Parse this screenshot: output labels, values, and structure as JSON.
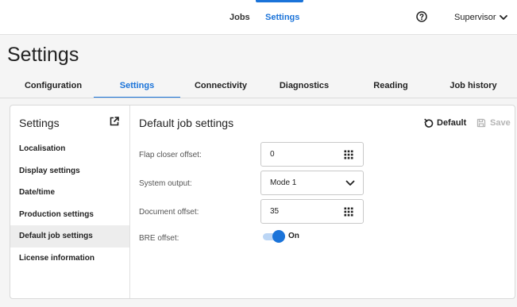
{
  "topnav": {
    "items": [
      {
        "label": "Jobs"
      },
      {
        "label": "Settings"
      }
    ],
    "user": "Supervisor",
    "accent": "#1a73d9"
  },
  "page": {
    "title": "Settings"
  },
  "tabs": [
    {
      "label": "Configuration"
    },
    {
      "label": "Settings"
    },
    {
      "label": "Connectivity"
    },
    {
      "label": "Diagnostics"
    },
    {
      "label": "Reading"
    },
    {
      "label": "Job history"
    }
  ],
  "sidebar": {
    "title": "Settings",
    "items": [
      {
        "label": "Localisation"
      },
      {
        "label": "Display settings"
      },
      {
        "label": "Date/time"
      },
      {
        "label": "Production settings"
      },
      {
        "label": "Default job settings"
      },
      {
        "label": "License information"
      }
    ]
  },
  "main": {
    "title": "Default job settings",
    "default_label": "Default",
    "save_label": "Save",
    "fields": {
      "flap_closer_offset": {
        "label": "Flap closer offset:",
        "value": "0"
      },
      "system_output": {
        "label": "System output:",
        "value": "Mode 1"
      },
      "document_offset": {
        "label": "Document offset:",
        "value": "35"
      },
      "bre_offset": {
        "label": "BRE offset:",
        "value": "On"
      }
    }
  }
}
